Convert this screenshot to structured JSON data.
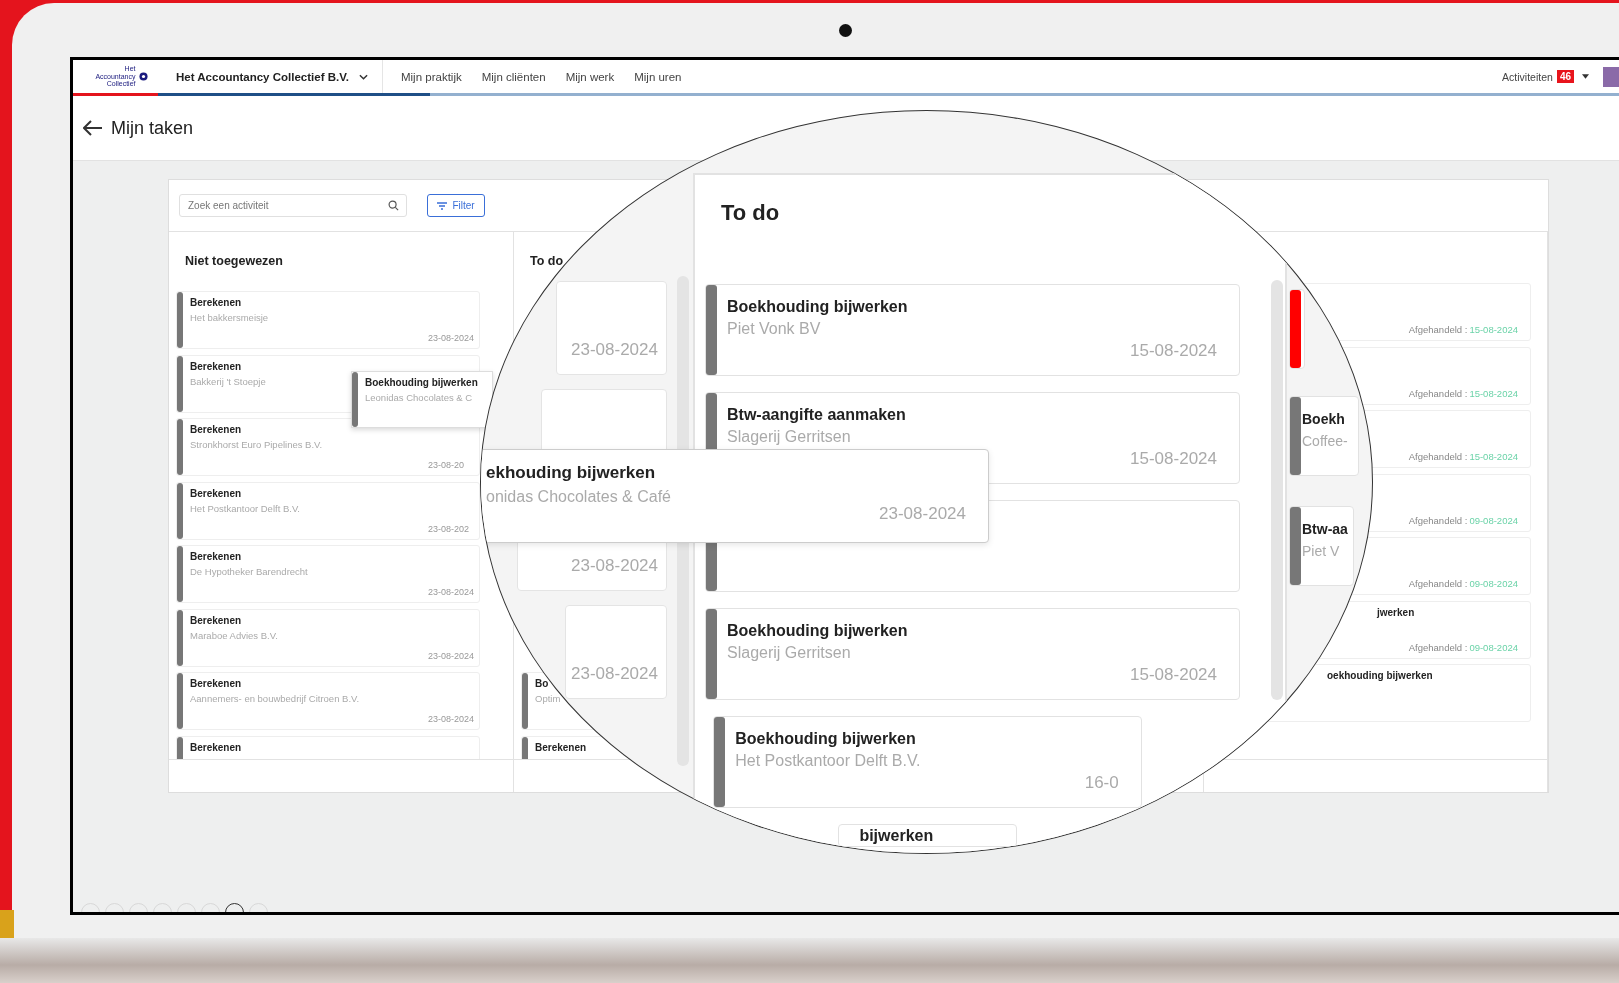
{
  "topbar": {
    "logo": "Het Accountancy Collectief",
    "company": "Het Accountancy Collectief B.V.",
    "nav": [
      "Mijn praktijk",
      "Mijn cliënten",
      "Mijn werk",
      "Mijn uren"
    ],
    "activities": "Activiteiten",
    "count": "46"
  },
  "page": {
    "title": "Mijn taken"
  },
  "board": {
    "search_placeholder": "Zoek een activiteit",
    "filter": "Filter",
    "left": {
      "heading": "Niet toegewezen",
      "cards": [
        {
          "title": "Berekenen",
          "client": "Het bakkersmeisje",
          "date": "23-08-2024"
        },
        {
          "title": "Berekenen",
          "client": "Bakkerij 't Stoepje"
        },
        {
          "title": "Berekenen",
          "client": "Stronkhorst Euro Pipelines B.V.",
          "date": "23-08-20"
        },
        {
          "title": "Berekenen",
          "client": "Het Postkantoor Delft B.V.",
          "date": "23-08-202"
        },
        {
          "title": "Berekenen",
          "client": "De Hypotheker Barendrecht",
          "date": "23-08-2024"
        },
        {
          "title": "Berekenen",
          "client": "Maraboe Advies B.V.",
          "date": "23-08-2024"
        },
        {
          "title": "Berekenen",
          "client": "Aannemers- en bouwbedrijf Citroen B.V.",
          "date": "23-08-2024"
        },
        {
          "title": "Berekenen"
        }
      ]
    },
    "middle": {
      "heading": "To do",
      "drag": {
        "title": "Boekhouding bijwerken",
        "client": "Leonidas Chocolates & C"
      },
      "cards": [
        {
          "title": "Bo",
          "client": "Optim"
        },
        {
          "title": "Berekenen"
        }
      ]
    },
    "right": {
      "cards": [
        {
          "status": "Afgehandeld :",
          "date": "15-08-2024"
        },
        {
          "status": "Afgehandeld :",
          "date": "15-08-2024"
        },
        {
          "status": "Afgehandeld :",
          "date": "15-08-2024"
        },
        {
          "status": "Afgehandeld :",
          "date": "09-08-2024"
        },
        {
          "status": "Afgehandeld :",
          "date": "09-08-2024"
        },
        {
          "title": "jwerken",
          "status": "Afgehandeld :",
          "date": "09-08-2024"
        },
        {
          "title": "oekhouding bijwerken"
        }
      ]
    }
  },
  "magnifier": {
    "strip_dates": [
      "23-08-2024",
      "23-08-2024",
      "23-08-2024"
    ],
    "heading": "To do",
    "cards": [
      {
        "title": "Boekhouding bijwerken",
        "client": "Piet Vonk BV",
        "date": "15-08-2024"
      },
      {
        "title": "Btw-aangifte aanmaken",
        "client": "Slagerij Gerritsen",
        "date": "15-08-2024"
      },
      {
        "title": "Boekhouding bijwerken",
        "client": "Slagerij Gerritsen",
        "date": "15-08-2024"
      },
      {
        "title": "Boekhouding bijwerken",
        "client": "Het Postkantoor Delft B.V.",
        "date": "16-0"
      },
      {
        "title": "bijwerken"
      }
    ],
    "drag": {
      "title": "ekhouding bijwerken",
      "client": "onidas Chocolates & Café",
      "date": "23-08-2024"
    },
    "right_cards": [
      {
        "color": "#ff0000"
      },
      {
        "title": "Boekh",
        "client": "Coffee-",
        "color": "#777777"
      },
      {
        "title": "Btw-aa",
        "client": "Piet V",
        "color": "#777777"
      }
    ]
  }
}
